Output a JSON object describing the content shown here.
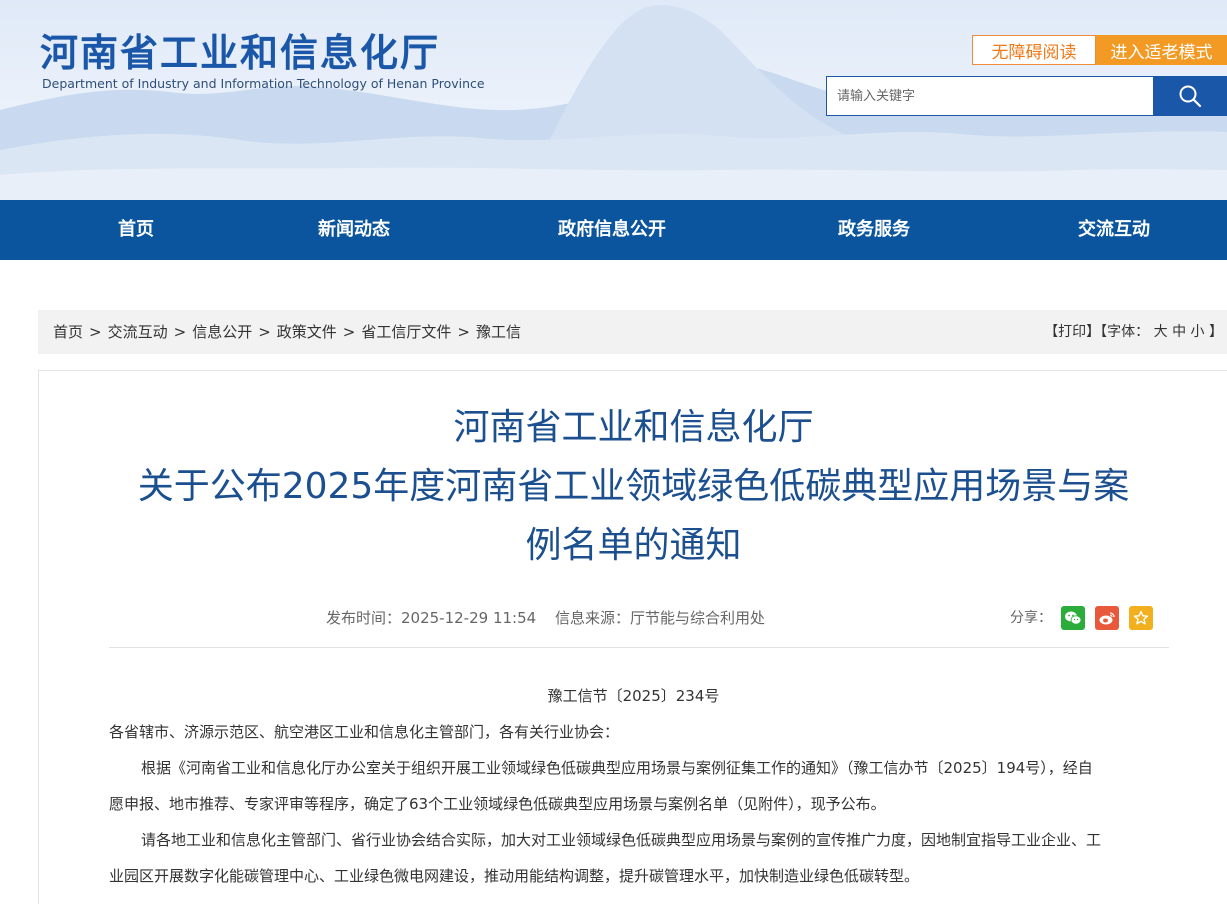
{
  "header": {
    "logo_cn": "河南省工业和信息化厅",
    "logo_en": "Department of Industry and Information Technology of Henan Province",
    "accessibility_btn": "无障碍阅读",
    "elder_mode_btn": "进入适老模式",
    "search_placeholder": "请输入关键字",
    "search_icon": "search-icon"
  },
  "nav": {
    "items": [
      "首页",
      "新闻动态",
      "政府信息公开",
      "政务服务",
      "交流互动"
    ]
  },
  "breadcrumb": {
    "items": [
      "首页",
      "交流互动",
      "信息公开",
      "政策文件",
      "省工信厅文件",
      "豫工信"
    ],
    "separator": ">",
    "tools": "【打印】【字体： 大 中 小 】"
  },
  "article": {
    "title_line1": "河南省工业和信息化厅",
    "title_line2": "关于公布2025年度河南省工业领域绿色低碳典型应用场景与案",
    "title_line3": "例名单的通知",
    "publish_time": "发布时间：2025-12-29 11:54",
    "source": "信息来源：厅节能与综合利用处",
    "share_label": "分享：",
    "doc_number": "豫工信节〔2025〕234号",
    "salutation": "各省辖市、济源示范区、航空港区工业和信息化主管部门，各有关行业协会：",
    "p1_line1": "根据《河南省工业和信息化厅办公室关于组织开展工业领域绿色低碳典型应用场景与案例征集工作的通知》（豫工信办节〔2025〕194号），经自",
    "p1_line2": "愿申报、地市推荐、专家评审等程序，确定了63个工业领域绿色低碳典型应用场景与案例名单（见附件），现予公布。",
    "p2_line1": "请各地工业和信息化主管部门、省行业协会结合实际，加大对工业领域绿色低碳典型应用场景与案例的宣传推广力度，因地制宜指导工业企业、工",
    "p2_line2": "业园区开展数字化能碳管理中心、工业绿色微电网建设，推动用能结构调整，提升碳管理水平，加快制造业绿色低碳转型。"
  },
  "colors": {
    "brand_blue": "#0b559e",
    "title_blue": "#1b4f8f",
    "orange": "#f39a25",
    "wechat_green": "#2bad3b",
    "weibo_red": "#e8583a",
    "favorite_yellow": "#f2b01e"
  }
}
